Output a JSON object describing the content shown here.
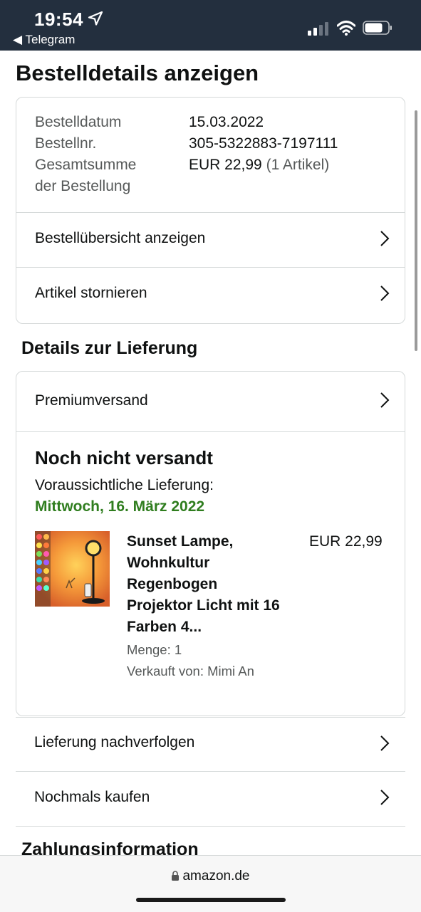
{
  "status_bar": {
    "time": "19:54",
    "back_label": "◀ Telegram"
  },
  "page": {
    "title": "Bestelldetails anzeigen"
  },
  "order_summary": {
    "date_label": "Bestelldatum",
    "date_value": "15.03.2022",
    "number_label": "Bestellnr.",
    "number_value": "305-5322883-7197111",
    "total_label_line1": "Gesamtsumme",
    "total_label_line2": "der Bestellung",
    "total_value": "EUR 22,99",
    "total_items": "(1 Artikel)"
  },
  "order_links": {
    "overview": "Bestellübersicht anzeigen",
    "cancel": "Artikel stornieren"
  },
  "delivery": {
    "section_title": "Details zur Lieferung",
    "shipping_method": "Premiumversand",
    "status": "Noch nicht versandt",
    "estimated_label": "Voraussichtliche Lieferung:",
    "estimated_date": "Mittwoch, 16. März 2022"
  },
  "product": {
    "title_lines": [
      "Sunset Lampe,",
      "Wohnkultur",
      "Regenbogen",
      "Projektor Licht mit 16",
      "Farben 4..."
    ],
    "price": "EUR 22,99",
    "quantity": "Menge: 1",
    "seller": "Verkauft von: Mimi An"
  },
  "actions": {
    "track": "Lieferung nachverfolgen",
    "buy_again": "Nochmals kaufen"
  },
  "payment": {
    "section_title": "Zahlungsinformation"
  },
  "browser": {
    "url": "amazon.de"
  },
  "colors": {
    "status_bar_bg": "#232f3e",
    "delivery_green": "#2f7d1e",
    "border": "#d5d9d9"
  },
  "icons": [
    "location-arrow-icon",
    "signal-icon",
    "wifi-icon",
    "battery-icon",
    "chevron-right-icon",
    "lock-icon"
  ]
}
